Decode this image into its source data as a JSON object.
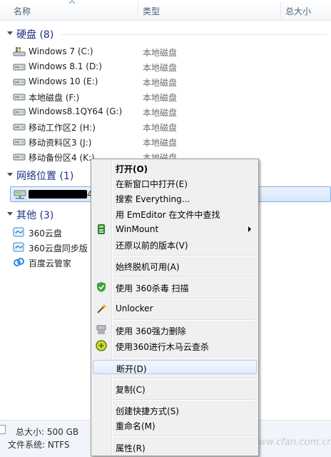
{
  "columns": {
    "name": "名称",
    "type": "类型",
    "size": "总大小"
  },
  "groups": {
    "disks": "硬盘 (8)",
    "network": "网络位置 (1)",
    "other": "其他 (3)"
  },
  "drives": [
    {
      "name": "Windows 7 (C:)",
      "type": "本地磁盘",
      "icon": "windows-drive-icon"
    },
    {
      "name": "Windows 8.1 (D:)",
      "type": "本地磁盘",
      "icon": "hard-drive-icon"
    },
    {
      "name": "Windows 10 (E:)",
      "type": "本地磁盘",
      "icon": "hard-drive-icon"
    },
    {
      "name": "本地磁盘 (F:)",
      "type": "本地磁盘",
      "icon": "hard-drive-icon"
    },
    {
      "name": "Windows8.1QY64 (G:)",
      "type": "本地磁盘",
      "icon": "hard-drive-icon"
    },
    {
      "name": "移动工作区2 (H:)",
      "type": "本地磁盘",
      "icon": "hard-drive-icon"
    },
    {
      "name": "移动资料区3 (J:)",
      "type": "本地磁盘",
      "icon": "hard-drive-icon"
    },
    {
      "name": "移动备份区4 (K:)",
      "type": "本地磁盘",
      "icon": "hard-drive-icon"
    }
  ],
  "network_item": {
    "suffix": "4",
    "icon": "network-drive-icon"
  },
  "other_items": [
    {
      "name": "360云盘",
      "icon": "cloud-360-icon"
    },
    {
      "name": "360云盘同步版",
      "icon": "cloud-360-sync-icon"
    },
    {
      "name": "百度云管家",
      "icon": "baidu-cloud-icon"
    }
  ],
  "status": {
    "total_size": "总大小:  500 GB",
    "filesystem": "文件系统:  NTFS"
  },
  "context_menu": {
    "open": "打开(O)",
    "open_new_window": "在新窗口中打开(E)",
    "search_everything": "搜索 Everything...",
    "emeditor_find": "用 EmEditor 在文件中查找",
    "winmount": "WinMount",
    "restore_previous": "还原以前的版本(V)",
    "always_offline": "始终脱机可用(A)",
    "scan_360": "使用 360杀毒 扫描",
    "unlocker": "Unlocker",
    "force_delete_360": "使用 360强力删除",
    "trojan_scan_360": "使用360进行木马云查杀",
    "disconnect": "断开(D)",
    "copy": "复制(C)",
    "create_shortcut": "创建快捷方式(S)",
    "rename": "重命名(M)",
    "properties": "属性(R)"
  },
  "watermark": "www.cfan.com.cn"
}
